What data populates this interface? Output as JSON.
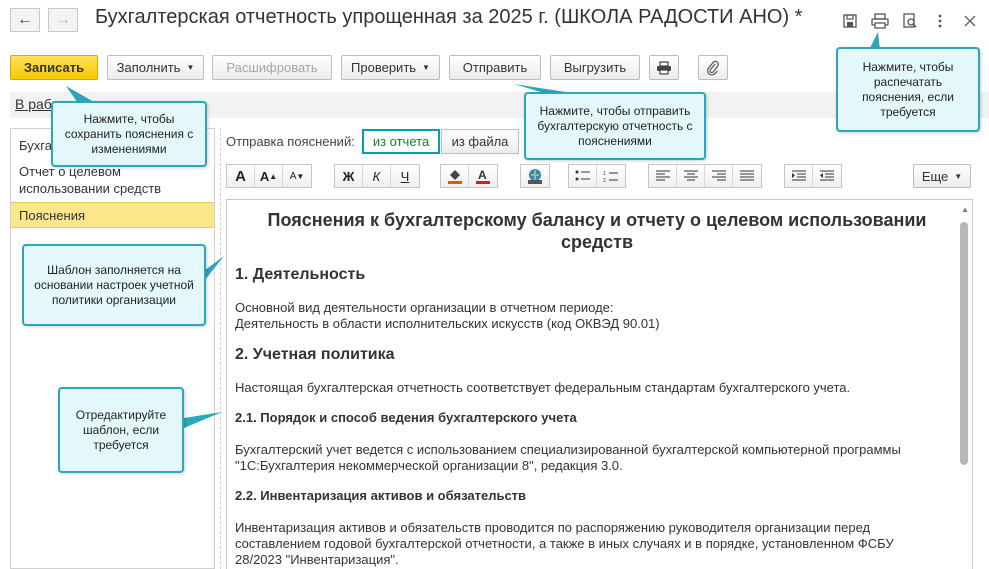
{
  "window": {
    "title": "Бухгалтерская отчетность упрощенная за 2025 г. (ШКОЛА РАДОСТИ АНО) *",
    "back_icon": "arrow-left",
    "forward_icon": "arrow-right",
    "icons": [
      "save-icon",
      "print-icon",
      "preview-icon",
      "more-icon",
      "close-icon"
    ]
  },
  "toolbar": {
    "save": "Записать",
    "fill": "Заполнить",
    "decode": "Расшифровать",
    "check": "Проверить",
    "send": "Отправить",
    "export": "Выгрузить"
  },
  "status": {
    "link": "В работе"
  },
  "sections": [
    {
      "label": "Бухгалтерский баланс"
    },
    {
      "label": "Отчет о целевом использовании средств"
    },
    {
      "label": "Пояснения"
    }
  ],
  "send": {
    "label": "Отправка пояснений:",
    "from_report": "из отчета",
    "from_file": "из файла"
  },
  "format": {
    "bold": "Ж",
    "italic": "К",
    "underline": "Ч",
    "more": "Еще"
  },
  "document": {
    "title": "Пояснения к бухгалтерскому балансу и отчету о целевом использовании средств",
    "s1_heading": "1. Деятельность",
    "s1_p1": "Основной вид деятельности организации в отчетном периоде:",
    "s1_p2": "Деятельность в области исполнительских искусств (код ОКВЭД 90.01)",
    "s2_heading": "2. Учетная политика",
    "s2_p1": "Настоящая бухгалтерская отчетность соответствует федеральным стандартам бухгалтерского учета.",
    "s21_heading": "2.1. Порядок и способ ведения бухгалтерского учета",
    "s21_p1": "Бухгалтерский учет ведется с использованием специализированной бухгалтерской компьютерной программы",
    "s21_p2": "\"1С:Бухгалтерия некоммерческой организации 8\", редакция 3.0.",
    "s22_heading": "2.2. Инвентаризация активов и обязательств",
    "s22_p1": "Инвентаризация активов и обязательств проводится по распоряжению руководителя организации перед",
    "s22_p2": "составлением годовой бухгалтерской отчетности, а также в иных случаях и в порядке, установленном ФСБУ",
    "s22_p3": "28/2023 \"Инвентаризация\"."
  },
  "callouts": {
    "save": "Нажмите, чтобы сохранить пояснения с изменениями",
    "send": "Нажмите, чтобы отправить бухгалтерскую отчетность с пояснениями",
    "print": "Нажмите, чтобы распечатать пояснения, если требуется",
    "template": "Шаблон заполняется на основании настроек учетной политики организации",
    "edit": "Отредактируйте шаблон, если требуется"
  },
  "colors": {
    "accent": "#2aa6bd",
    "callout_bg": "#e4f7fb",
    "primary_button": "#f6c800",
    "active_section": "#fbe78b"
  }
}
